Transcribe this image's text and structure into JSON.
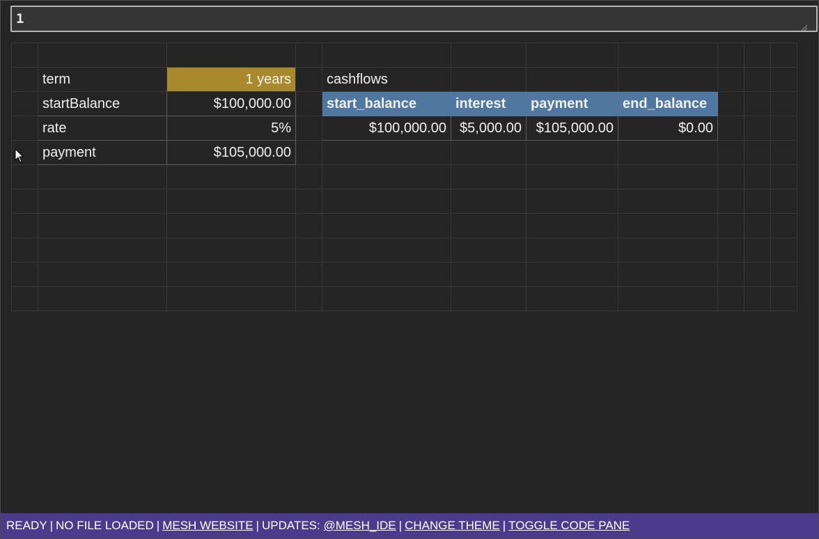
{
  "formula_bar": {
    "value": "1"
  },
  "inputs": {
    "term_label": "term",
    "term_value": "1 years",
    "start_balance_label": "startBalance",
    "start_balance_value": "$100,000.00",
    "rate_label": "rate",
    "rate_value": "5%",
    "payment_label": "payment",
    "payment_value": "$105,000.00"
  },
  "cashflows": {
    "title": "cashflows",
    "columns": [
      "start_balance",
      "interest",
      "payment",
      "end_balance"
    ],
    "rows": [
      [
        "$100,000.00",
        "$5,000.00",
        "$105,000.00",
        "$0.00"
      ]
    ]
  },
  "status_bar": {
    "ready": "READY",
    "file_status": "NO FILE LOADED",
    "website_link": "MESH WEBSITE",
    "updates_prefix": "UPDATES:",
    "updates_link": "@MESH_IDE",
    "theme_link": "CHANGE THEME",
    "toggle_link": "TOGGLE CODE PANE"
  },
  "colors": {
    "background": "#252525",
    "label": "#f07878",
    "input_blue": "#5a9cf0",
    "selected_cell": "#a88a2c",
    "table_header": "#4f77a0",
    "status_bar": "#4a3b8c"
  },
  "icons": {
    "cursor": "mouse-pointer-icon",
    "resize": "resize-grip-icon"
  }
}
